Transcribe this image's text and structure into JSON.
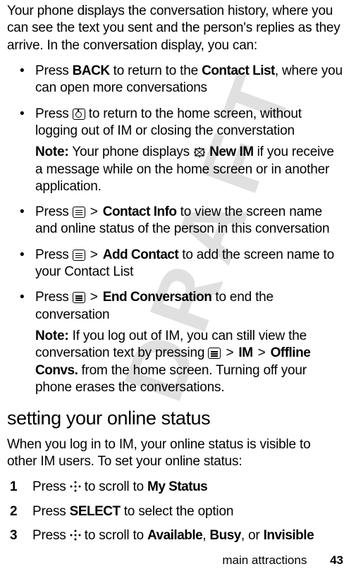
{
  "intro": "Your phone displays the conversation history, where you can see the text you sent and the person's replies as they arrive. In the conversation display, you can:",
  "bullets": [
    {
      "pre": "Press ",
      "key": "BACK",
      "mid": " to return to the ",
      "key2": "Contact List",
      "post": ", where you can open more conversations"
    },
    {
      "pre": "Press ",
      "icon": "home",
      "post": " to return to the home screen, without logging out of IM or closing the converstation",
      "note_label": "Note:",
      "note_pre": " Your phone displays ",
      "note_icon": "newim",
      "note_key": "New IM",
      "note_post": " if you receive a message while on the home screen or in another application."
    },
    {
      "pre": "Press ",
      "icon": "menu",
      "gt": " > ",
      "key": "Contact Info",
      "post": " to view the screen name and online status of the person in this conversation"
    },
    {
      "pre": "Press ",
      "icon": "menu",
      "gt": " > ",
      "key": "Add Contact",
      "post": " to add the screen name to your Contact List"
    },
    {
      "pre": "Press ",
      "icon": "menu",
      "gt": " > ",
      "key": "End Conversation",
      "post": " to end the conversation",
      "note_label": "Note:",
      "note_pre": " If you log out of IM, you can still view the conversation text by pressing ",
      "note_icon": "menu",
      "note_gt1": " > ",
      "note_key1": "IM",
      "note_gt2": " > ",
      "note_key2": "Offline Convs.",
      "note_post": " from the home screen. Turning off your phone erases the conversations."
    }
  ],
  "heading": "setting your online status",
  "sub_intro": "When you log in to IM, your online status is visible to other IM users. To set your online status:",
  "steps": [
    {
      "pre": "Press ",
      "icon": "nav",
      "mid": " to scroll to ",
      "key": "My Status"
    },
    {
      "pre": "Press ",
      "key": "SELECT",
      "post": " to select the option"
    },
    {
      "pre": "Press ",
      "icon": "nav",
      "mid": " to scroll to ",
      "key": "Available",
      "sep1": ", ",
      "key2": "Busy",
      "sep2": ", or ",
      "key3": "Invisible"
    }
  ],
  "footer_section": "main attractions",
  "footer_page": "43"
}
